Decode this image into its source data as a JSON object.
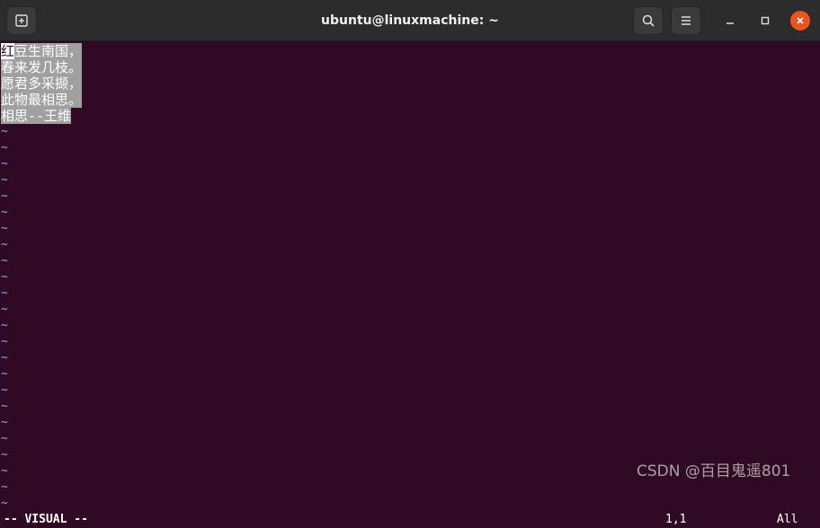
{
  "window": {
    "title": "ubuntu@linuxmachine: ~"
  },
  "icons": {
    "new_tab": "new-tab-icon",
    "search": "search-icon",
    "menu": "hamburger-menu-icon",
    "minimize": "minimize-icon",
    "maximize": "maximize-icon",
    "close": "close-icon"
  },
  "colors": {
    "terminal_bg": "#300a24",
    "selection_bg": "#a0a0a0",
    "tilde": "#8ba7ff",
    "close_button": "#e95420",
    "titlebar": "#2c2c2c"
  },
  "editor": {
    "cursor_char": "红",
    "line1_rest": "豆生南国，",
    "lines": [
      "春来发几枝。",
      "愿君多采撷，",
      "此物最相思。",
      "相思--王维"
    ],
    "empty_line_marker": "~",
    "empty_line_count": 24
  },
  "status": {
    "mode": "-- VISUAL --",
    "position": "1,1",
    "percent": "All"
  },
  "watermark": "CSDN @百目鬼遥801"
}
